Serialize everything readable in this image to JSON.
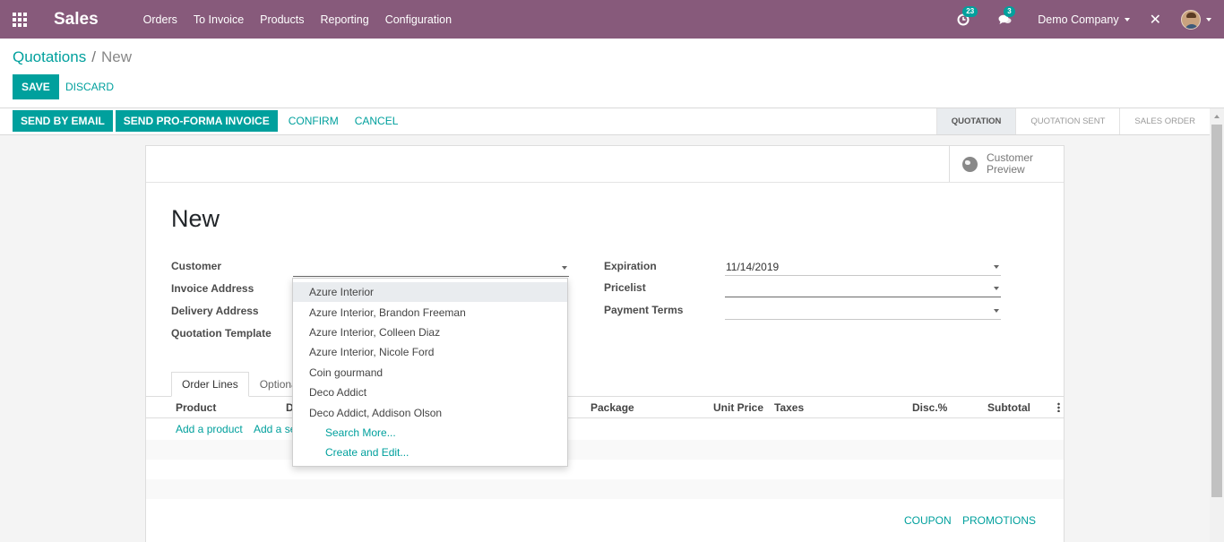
{
  "navbar": {
    "brand": "Sales",
    "menu": [
      "Orders",
      "To Invoice",
      "Products",
      "Reporting",
      "Configuration"
    ],
    "activity_count": "23",
    "message_count": "3",
    "company": "Demo Company",
    "color": "#875a7b"
  },
  "breadcrumb": {
    "parent": "Quotations",
    "separator": "/",
    "current": "New"
  },
  "control": {
    "save": "SAVE",
    "discard": "DISCARD"
  },
  "statusbar": {
    "buttons": [
      "SEND BY EMAIL",
      "SEND PRO-FORMA INVOICE"
    ],
    "links": [
      "CONFIRM",
      "CANCEL"
    ],
    "stages": [
      "QUOTATION",
      "QUOTATION SENT",
      "SALES ORDER"
    ],
    "active_stage": "QUOTATION"
  },
  "form": {
    "customer_preview": [
      "Customer",
      "Preview"
    ],
    "title": "New",
    "labels": {
      "customer": "Customer",
      "invoice_address": "Invoice Address",
      "delivery_address": "Delivery Address",
      "quotation_template": "Quotation Template",
      "expiration": "Expiration",
      "pricelist": "Pricelist",
      "payment_terms": "Payment Terms"
    },
    "values": {
      "expiration": "11/14/2019"
    },
    "tabs": [
      "Order Lines",
      "Optiona"
    ],
    "columns": [
      "Product",
      "D",
      "Package",
      "Unit Price",
      "Taxes",
      "Disc.%",
      "Subtotal"
    ],
    "add_product": "Add a product",
    "add_section": "Add a se",
    "coupon": "COUPON",
    "promotions": "PROMOTIONS"
  },
  "dropdown": {
    "items": [
      "Azure Interior",
      "Azure Interior, Brandon Freeman",
      "Azure Interior, Colleen Diaz",
      "Azure Interior, Nicole Ford",
      "Coin gourmand",
      "Deco Addict",
      "Deco Addict, Addison Olson"
    ],
    "search_more": "Search More...",
    "create_edit": "Create and Edit..."
  },
  "colors": {
    "accent": "#00a09d",
    "brand": "#875a7b"
  }
}
